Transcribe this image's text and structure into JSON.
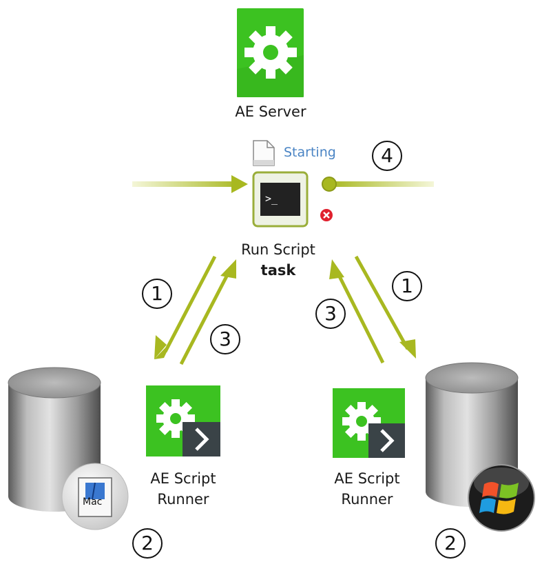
{
  "server": {
    "label": "AE Server"
  },
  "task": {
    "status": "Starting",
    "step_top": "4",
    "name": "Run Script",
    "sub": "task"
  },
  "runners": {
    "left": {
      "line1": "AE Script",
      "line2": "Runner"
    },
    "right": {
      "line1": "AE Script",
      "line2": "Runner"
    }
  },
  "steps": {
    "left_1": "1",
    "left_3": "3",
    "right_1": "1",
    "right_3": "3",
    "left_2": "2",
    "right_2": "2"
  },
  "badges": {
    "mac": "Mac"
  },
  "colors": {
    "green": "#3cc221",
    "arrow": "#a8b820",
    "status": "#4a84c4",
    "error": "#e0202e"
  }
}
